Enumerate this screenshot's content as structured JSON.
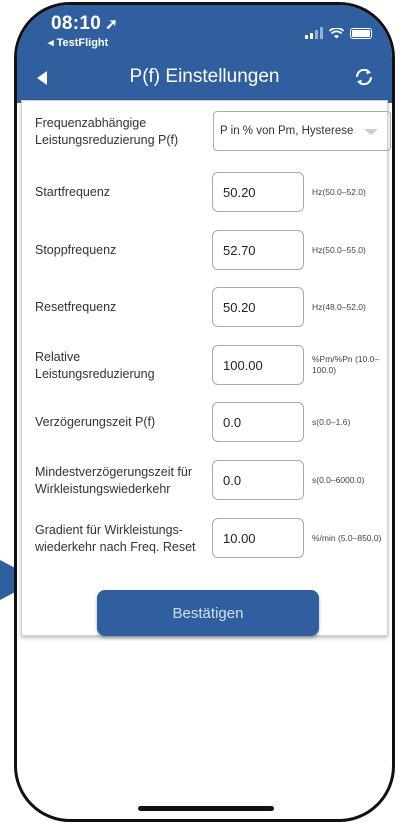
{
  "status_bar": {
    "time": "08:10",
    "back_app": "TestFlight"
  },
  "header": {
    "title": "P(f) Einstellungen"
  },
  "mode": {
    "label": "Frequenzabhängige Leistungsreduzierung P(f)",
    "selected": "P in % von Pm, Hysterese"
  },
  "fields": [
    {
      "label": "Startfrequenz",
      "value": "50.20",
      "range": "Hz(50.0–52.0)"
    },
    {
      "label": "Stoppfrequenz",
      "value": "52.70",
      "range": "Hz(50.0–55.0)"
    },
    {
      "label": "Resetfrequenz",
      "value": "50.20",
      "range": "Hz(48.0–52.0)"
    },
    {
      "label": "Relative Leistungsreduzierung",
      "value": "100.00",
      "range": "%Pm/%Pn (10.0–100.0)"
    },
    {
      "label": "Verzögerungszeit P(f)",
      "value": "0.0",
      "range": "s(0.0–1.6)"
    },
    {
      "label": "Mindestverzögerungszeit für Wirkleistungswiederkehr",
      "value": "0.0",
      "range": "s(0.0–6000.0)"
    },
    {
      "label": "Gradient für Wirkleistungs-wiederkehr nach Freq. Reset",
      "value": "10.00",
      "range": "%/min  (5.0–850.0)"
    }
  ],
  "confirm_label": "Bestätigen",
  "colors": {
    "accent": "#2f5f9e"
  }
}
